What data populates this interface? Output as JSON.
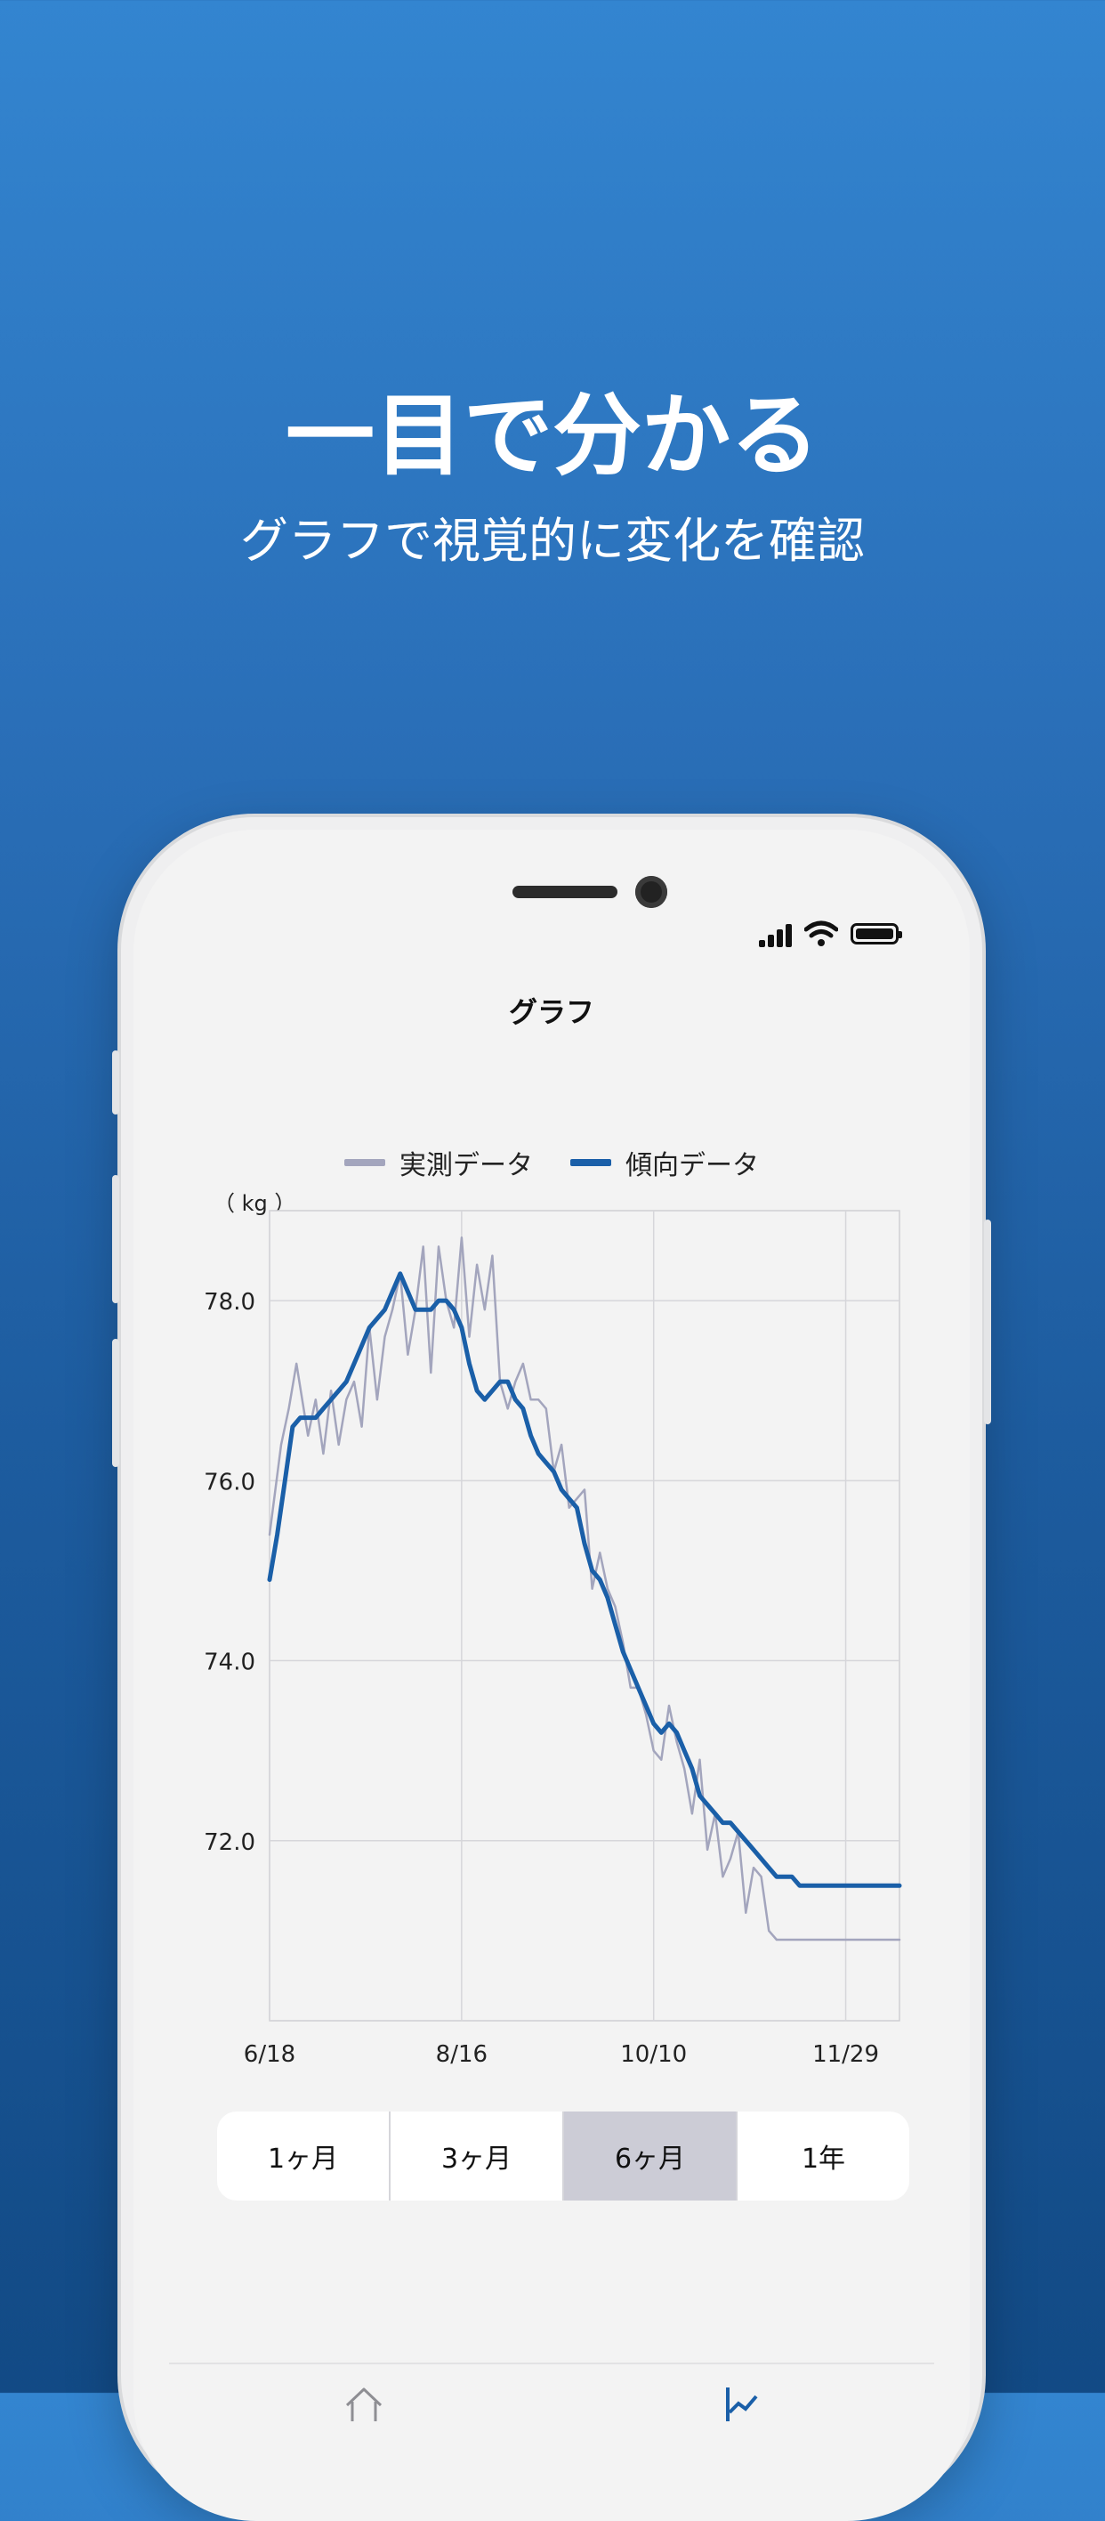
{
  "promo": {
    "headline": "一目で分かる",
    "subline": "グラフで視覚的に変化を確認"
  },
  "screen": {
    "title": "グラフ",
    "unit": "（ kg ）"
  },
  "legend": [
    {
      "label": "実測データ",
      "color": "#a3a5bd"
    },
    {
      "label": "傾向データ",
      "color": "#1a5fa8"
    }
  ],
  "segments": [
    {
      "label": "1ヶ月",
      "selected": false
    },
    {
      "label": "3ヶ月",
      "selected": false
    },
    {
      "label": "6ヶ月",
      "selected": true
    },
    {
      "label": "1年",
      "selected": false
    }
  ],
  "tabbar": {
    "items": [
      {
        "icon": "home-icon"
      },
      {
        "icon": "graph-icon",
        "selected": true
      }
    ]
  },
  "chart_data": {
    "type": "line",
    "title": "",
    "ylabel": "kg",
    "ylim": [
      70.0,
      79.0
    ],
    "xlim": [
      0,
      164
    ],
    "grid": true,
    "legend_position": "top-center",
    "y_ticks": [
      "78.0",
      "76.0",
      "74.0",
      "72.0"
    ],
    "y_tick_values": [
      78,
      76,
      74,
      72
    ],
    "x_ticks": [
      "6/18",
      "8/16",
      "10/10",
      "11/29"
    ],
    "x_tick_values": [
      0,
      50,
      100,
      150
    ],
    "series": [
      {
        "name": "実測データ",
        "color": "#a3a5bd",
        "x": [
          0,
          3,
          5,
          7,
          10,
          12,
          14,
          16,
          18,
          20,
          22,
          24,
          26,
          28,
          30,
          32,
          34,
          36,
          38,
          40,
          42,
          44,
          46,
          48,
          50,
          52,
          54,
          56,
          58,
          60,
          62,
          64,
          66,
          68,
          70,
          72,
          74,
          76,
          78,
          80,
          82,
          84,
          86,
          88,
          90,
          92,
          94,
          96,
          98,
          100,
          102,
          104,
          106,
          108,
          110,
          112,
          114,
          116,
          118,
          120,
          122,
          124,
          126,
          128,
          130,
          132,
          134,
          136,
          138,
          140,
          142,
          144,
          146,
          148,
          150,
          152,
          154,
          156,
          158,
          160,
          162,
          164
        ],
        "values": [
          75.4,
          76.4,
          76.8,
          77.3,
          76.5,
          76.9,
          76.3,
          77.0,
          76.4,
          76.9,
          77.1,
          76.6,
          77.7,
          76.9,
          77.6,
          77.9,
          78.3,
          77.4,
          77.9,
          78.6,
          77.2,
          78.6,
          78.0,
          77.7,
          78.7,
          77.6,
          78.4,
          77.9,
          78.5,
          77.1,
          76.8,
          77.1,
          77.3,
          76.9,
          76.9,
          76.8,
          76.1,
          76.4,
          75.7,
          75.8,
          75.9,
          74.8,
          75.2,
          74.8,
          74.6,
          74.2,
          73.7,
          73.7,
          73.4,
          73.0,
          72.9,
          73.5,
          73.1,
          72.8,
          72.3,
          72.9,
          71.9,
          72.3,
          71.6,
          71.8,
          72.1,
          71.2,
          71.7,
          71.6,
          71.0,
          70.9,
          70.9,
          70.9,
          70.9,
          70.9,
          70.9,
          70.9,
          70.9,
          70.9,
          70.9,
          70.9,
          70.9,
          70.9,
          70.9,
          70.9,
          70.9,
          70.9
        ]
      },
      {
        "name": "傾向データ",
        "color": "#1a5fa8",
        "x": [
          0,
          2,
          4,
          6,
          8,
          10,
          12,
          14,
          16,
          18,
          20,
          22,
          24,
          26,
          28,
          30,
          32,
          34,
          36,
          38,
          40,
          42,
          44,
          46,
          48,
          50,
          52,
          54,
          56,
          58,
          60,
          62,
          64,
          66,
          68,
          70,
          72,
          74,
          76,
          78,
          80,
          82,
          84,
          86,
          88,
          90,
          92,
          94,
          96,
          98,
          100,
          102,
          104,
          106,
          108,
          110,
          112,
          114,
          116,
          118,
          120,
          122,
          124,
          126,
          128,
          130,
          132,
          134,
          136,
          138,
          140,
          142,
          144,
          146,
          148,
          150,
          152,
          154,
          156,
          158,
          160,
          162,
          164
        ],
        "values": [
          74.9,
          75.4,
          76.0,
          76.6,
          76.7,
          76.7,
          76.7,
          76.8,
          76.9,
          77.0,
          77.1,
          77.3,
          77.5,
          77.7,
          77.8,
          77.9,
          78.1,
          78.3,
          78.1,
          77.9,
          77.9,
          77.9,
          78.0,
          78.0,
          77.9,
          77.7,
          77.3,
          77.0,
          76.9,
          77.0,
          77.1,
          77.1,
          76.9,
          76.8,
          76.5,
          76.3,
          76.2,
          76.1,
          75.9,
          75.8,
          75.7,
          75.3,
          75.0,
          74.9,
          74.7,
          74.4,
          74.1,
          73.9,
          73.7,
          73.5,
          73.3,
          73.2,
          73.3,
          73.2,
          73.0,
          72.8,
          72.5,
          72.4,
          72.3,
          72.2,
          72.2,
          72.1,
          72.0,
          71.9,
          71.8,
          71.7,
          71.6,
          71.6,
          71.6,
          71.5,
          71.5,
          71.5,
          71.5,
          71.5,
          71.5,
          71.5,
          71.5,
          71.5,
          71.5,
          71.5,
          71.5,
          71.5,
          71.5
        ]
      }
    ]
  }
}
